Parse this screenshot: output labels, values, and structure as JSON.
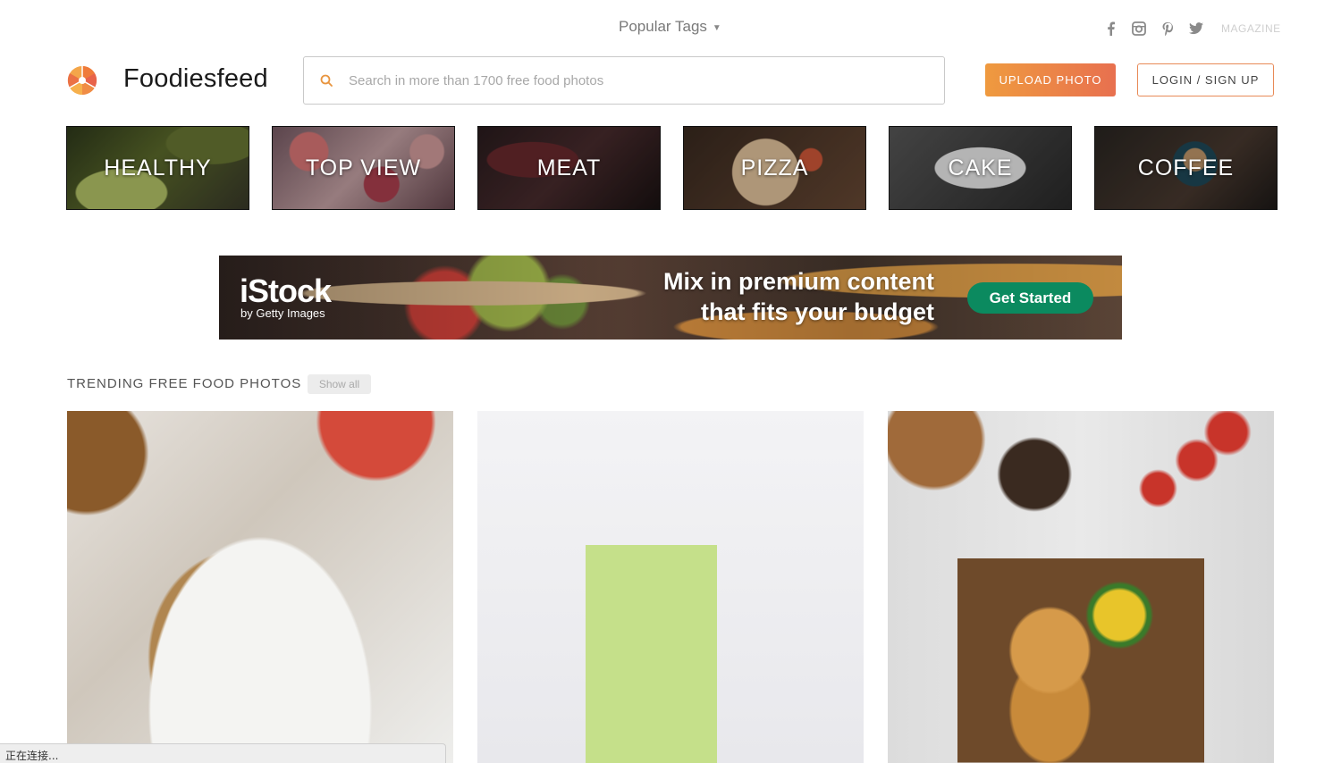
{
  "topbar": {
    "popular_tags": "Popular Tags",
    "social_icons": [
      "facebook-icon",
      "instagram-icon",
      "pinterest-icon",
      "twitter-icon"
    ],
    "magazine": "MAGAZINE"
  },
  "header": {
    "brand": "Foodiesfeed",
    "search_placeholder": "Search in more than 1700 free food photos",
    "upload_label": "UPLOAD PHOTO",
    "login_label": "LOGIN / SIGN UP"
  },
  "categories": [
    {
      "label": "HEALTHY"
    },
    {
      "label": "TOP VIEW"
    },
    {
      "label": "MEAT"
    },
    {
      "label": "PIZZA"
    },
    {
      "label": "CAKE"
    },
    {
      "label": "COFFEE"
    }
  ],
  "ad": {
    "brand": "iStock",
    "sub_brand": "by Getty Images",
    "headline_1": "Mix in premium content",
    "headline_2": "that fits your budget",
    "cta": "Get Started"
  },
  "trending": {
    "title": "TRENDING FREE FOOD PHOTOS",
    "show_all": "Show all"
  },
  "status_bar": "正在连接...",
  "colors": {
    "accent_orange": "#ef9a3f",
    "accent_red": "#e8704f",
    "cta_green": "#0b8a5f"
  }
}
